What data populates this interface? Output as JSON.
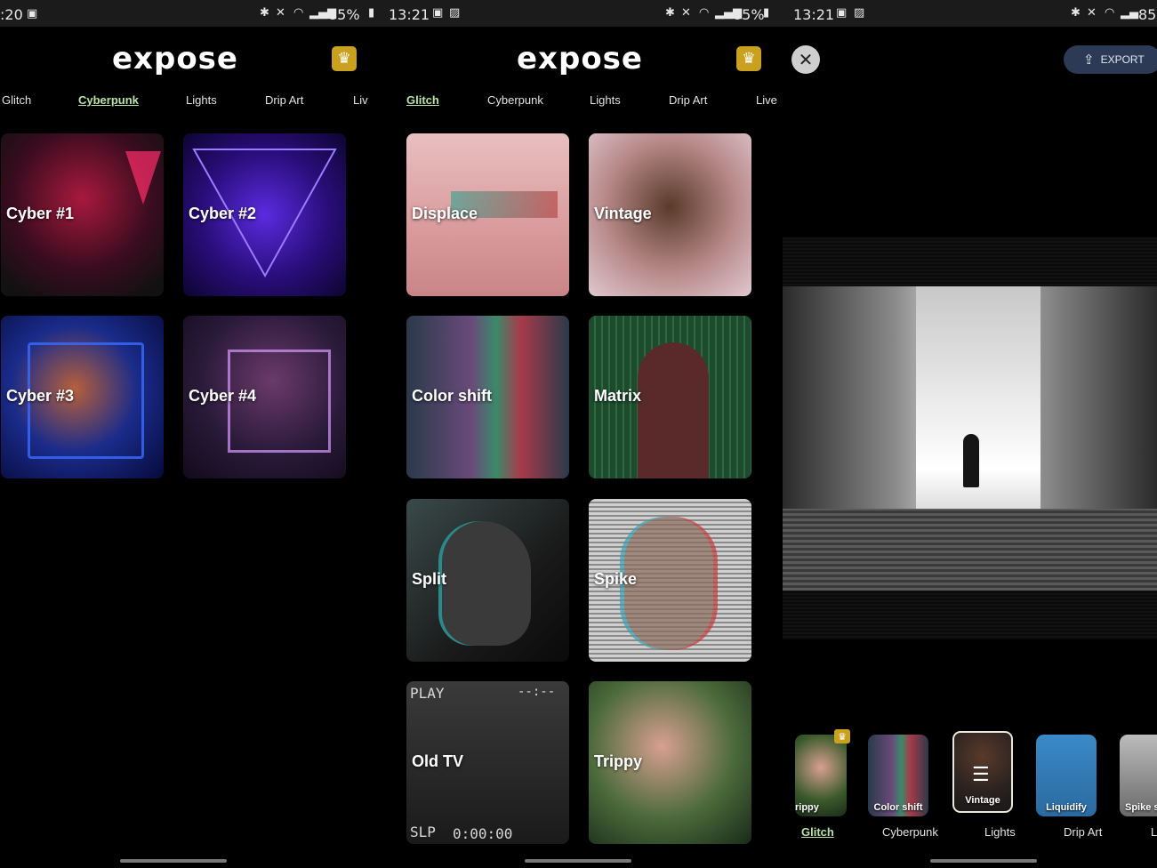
{
  "status": {
    "left_time": ":20",
    "mid_time": "13:21",
    "right_time": "13:21",
    "battery": "85%",
    "battery_right": "85"
  },
  "panel1": {
    "logo": "expose",
    "tabs": [
      "Glitch",
      "Cyberpunk",
      "Lights",
      "Drip Art",
      "Liv"
    ],
    "active_tab": "Cyberpunk",
    "cards": [
      "Cyber #1",
      "Cyber #2",
      "Cyber #3",
      "Cyber #4"
    ]
  },
  "panel2": {
    "logo": "expose",
    "tabs": [
      "Glitch",
      "Cyberpunk",
      "Lights",
      "Drip Art",
      "Live"
    ],
    "active_tab": "Glitch",
    "cards": [
      "Displace",
      "Vintage",
      "Color shift",
      "Matrix",
      "Split",
      "Spike",
      "Old TV",
      "Trippy"
    ],
    "oldtv_overlay": {
      "play": "PLAY",
      "slp": "SLP",
      "counter": "0:00:00",
      "dashes": "--:--"
    }
  },
  "panel3": {
    "export_label": "EXPORT",
    "thumbs": [
      "rippy",
      "Color shift",
      "Vintage",
      "Liquidify",
      "Spike s"
    ],
    "tabs": [
      "Glitch",
      "Cyberpunk",
      "Lights",
      "Drip Art",
      "L"
    ],
    "active_tab": "Glitch"
  },
  "colors": {
    "accent": "#b9e3a4",
    "crown": "#c9a11e",
    "export_bg": "#2d3a55"
  },
  "icons": [
    "bluetooth-icon",
    "mute-icon",
    "wifi-icon",
    "signal-icon",
    "crown-icon",
    "close-icon",
    "share-icon",
    "sliders-icon"
  ]
}
